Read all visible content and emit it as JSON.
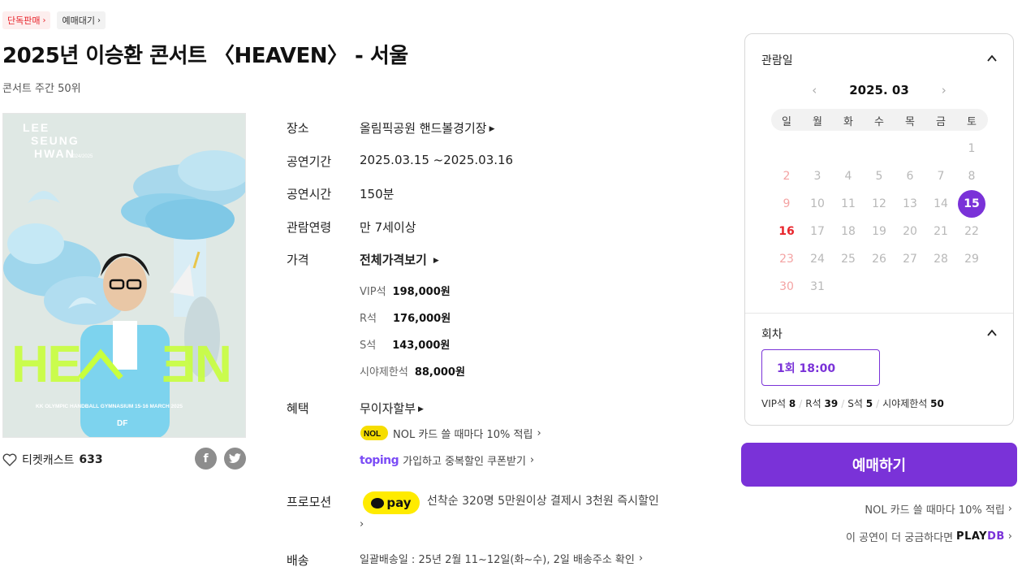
{
  "badges": {
    "exclusive": "단독판매",
    "presale": "예매대기"
  },
  "title": "2025년 이승환 콘서트 〈HEAVEN〉 - 서울",
  "rank": "콘서트 주간 50위",
  "poster": {
    "name_line1": "LEE",
    "name_line2": "SEUNG",
    "name_line3": "HWAN",
    "years": "2024/2025",
    "heaven": "HEAVEN",
    "venue_line": "KK OLYMPIC HANDBALL GYMNASIUM 15-16 MARCH 2025",
    "logo": "DF"
  },
  "ticketcast": {
    "label": "티켓캐스트",
    "count": "633"
  },
  "info": {
    "venue_label": "장소",
    "venue_value": "올림픽공원 핸드볼경기장",
    "period_label": "공연기간",
    "period_value": "2025.03.15 ~2025.03.16",
    "runtime_label": "공연시간",
    "runtime_value": "150분",
    "age_label": "관람연령",
    "age_value": "만 7세이상",
    "price_label": "가격",
    "price_all": "전체가격보기",
    "prices": [
      {
        "seat": "VIP석",
        "amount": "198,000원"
      },
      {
        "seat": "R석",
        "amount": "176,000원"
      },
      {
        "seat": "S석",
        "amount": "143,000원"
      },
      {
        "seat": "시야제한석",
        "amount": "88,000원"
      }
    ],
    "benefit_label": "혜택",
    "benefit_value": "무이자할부",
    "nol_logo": "NOL",
    "nol_text": "NOL 카드 쓸 때마다 10% 적립",
    "toping_logo": "toping",
    "toping_text": "가입하고 중복할인 쿠폰받기",
    "promo_label": "프로모션",
    "kpay": "pay",
    "promo_text": "선착순 320명 5만원이상 결제시 3천원 즉시할인",
    "delivery_label": "배송",
    "delivery_value": "일괄배송일 : 25년 2월 11~12일(화~수), 2일 배송주소 확인"
  },
  "calendar": {
    "label": "관람일",
    "month": "2025. 03",
    "weekdays": [
      "일",
      "월",
      "화",
      "수",
      "목",
      "금",
      "토"
    ],
    "days": [
      "1",
      "2",
      "3",
      "4",
      "5",
      "6",
      "7",
      "8",
      "9",
      "10",
      "11",
      "12",
      "13",
      "14",
      "15",
      "16",
      "17",
      "18",
      "19",
      "20",
      "21",
      "22",
      "23",
      "24",
      "25",
      "26",
      "27",
      "28",
      "29",
      "30",
      "31"
    ],
    "selected_day": "15",
    "available_day": "16"
  },
  "session": {
    "label": "회차",
    "round": "1회 18:00",
    "seats": [
      {
        "name": "VIP석",
        "count": "8"
      },
      {
        "name": "R석",
        "count": "39"
      },
      {
        "name": "S석",
        "count": "5"
      },
      {
        "name": "시야제한석",
        "count": "50"
      }
    ]
  },
  "book_button": "예매하기",
  "side_links": {
    "nol_text": "NOL 카드 쓸 때마다 10% 적립",
    "more_text": "이 공연이 더 궁금하다면",
    "playdb_a": "PLAY",
    "playdb_b": "DB"
  },
  "colors": {
    "accent": "#7a32d8",
    "sunday": "#e8242b",
    "kakao": "#ffeb00"
  }
}
